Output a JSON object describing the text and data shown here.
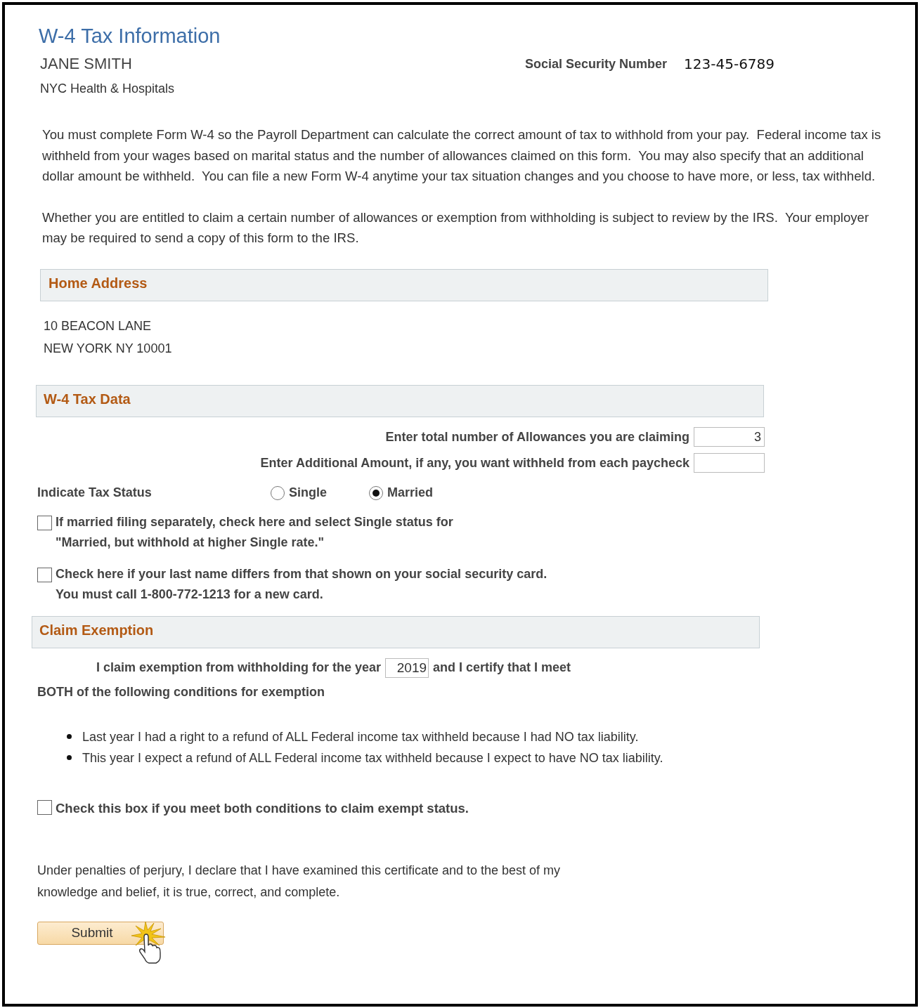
{
  "title": "W-4 Tax Information",
  "employee": {
    "name": "JANE SMITH",
    "employer": "NYC Health & Hospitals",
    "ssn_label": "Social Security Number",
    "ssn": "123-45-6789"
  },
  "intro": [
    "You must complete Form W-4 so the Payroll Department can calculate the correct amount of tax to withhold from your pay.  Federal income tax is withheld from your wages based on marital status and the number of allowances claimed on this form.  You may also specify that an additional dollar amount be withheld.  You can file a new Form W-4 anytime your tax situation changes and you choose to have more, or less, tax withheld.",
    "Whether you are entitled to claim a certain number of allowances or exemption from withholding is subject to review by the IRS.  Your employer may be required to send a copy of this form to the IRS."
  ],
  "home_address": {
    "heading": "Home Address",
    "lines": [
      "10 BEACON LANE",
      "NEW YORK NY 10001"
    ]
  },
  "tax_data": {
    "heading": "W-4 Tax Data",
    "fields": [
      {
        "label": "Enter total number of Allowances you are claiming",
        "value": "3"
      },
      {
        "label": "Enter Additional Amount, if any, you want withheld from each paycheck"
      }
    ],
    "status_label": "Indicate Tax Status",
    "statuses": [
      {
        "label": "Single",
        "selected": false
      },
      {
        "label": "Married",
        "selected": true
      }
    ],
    "checks": [
      {
        "lines": [
          "If married filing separately, check here and select Single status for",
          "\"Married, but withhold at higher Single rate.\""
        ],
        "checked": false
      },
      {
        "lines": [
          "Check here if your last name differs from that shown on your social security card.",
          "You must call 1-800-772-1213 for a new card."
        ],
        "checked": false
      }
    ]
  },
  "exemption": {
    "heading": "Claim Exemption",
    "before": "I claim exemption from withholding for the year",
    "year": "2019",
    "after": "and I certify that I meet",
    "second_line": "BOTH of the following conditions for exemption",
    "conditions": [
      "Last year I had a right to a refund of ALL Federal income tax withheld because I had NO tax liability.",
      "This year I expect a refund of ALL Federal income tax withheld because I expect to have NO tax liability."
    ],
    "check": {
      "label": "Check this box if you meet both conditions to claim exempt status.",
      "checked": false
    }
  },
  "declaration": [
    "Under penalties of perjury, I declare that I have examined this certificate and to the best of my",
    "knowledge and belief, it is true, correct, and complete."
  ],
  "submit": "Submit"
}
